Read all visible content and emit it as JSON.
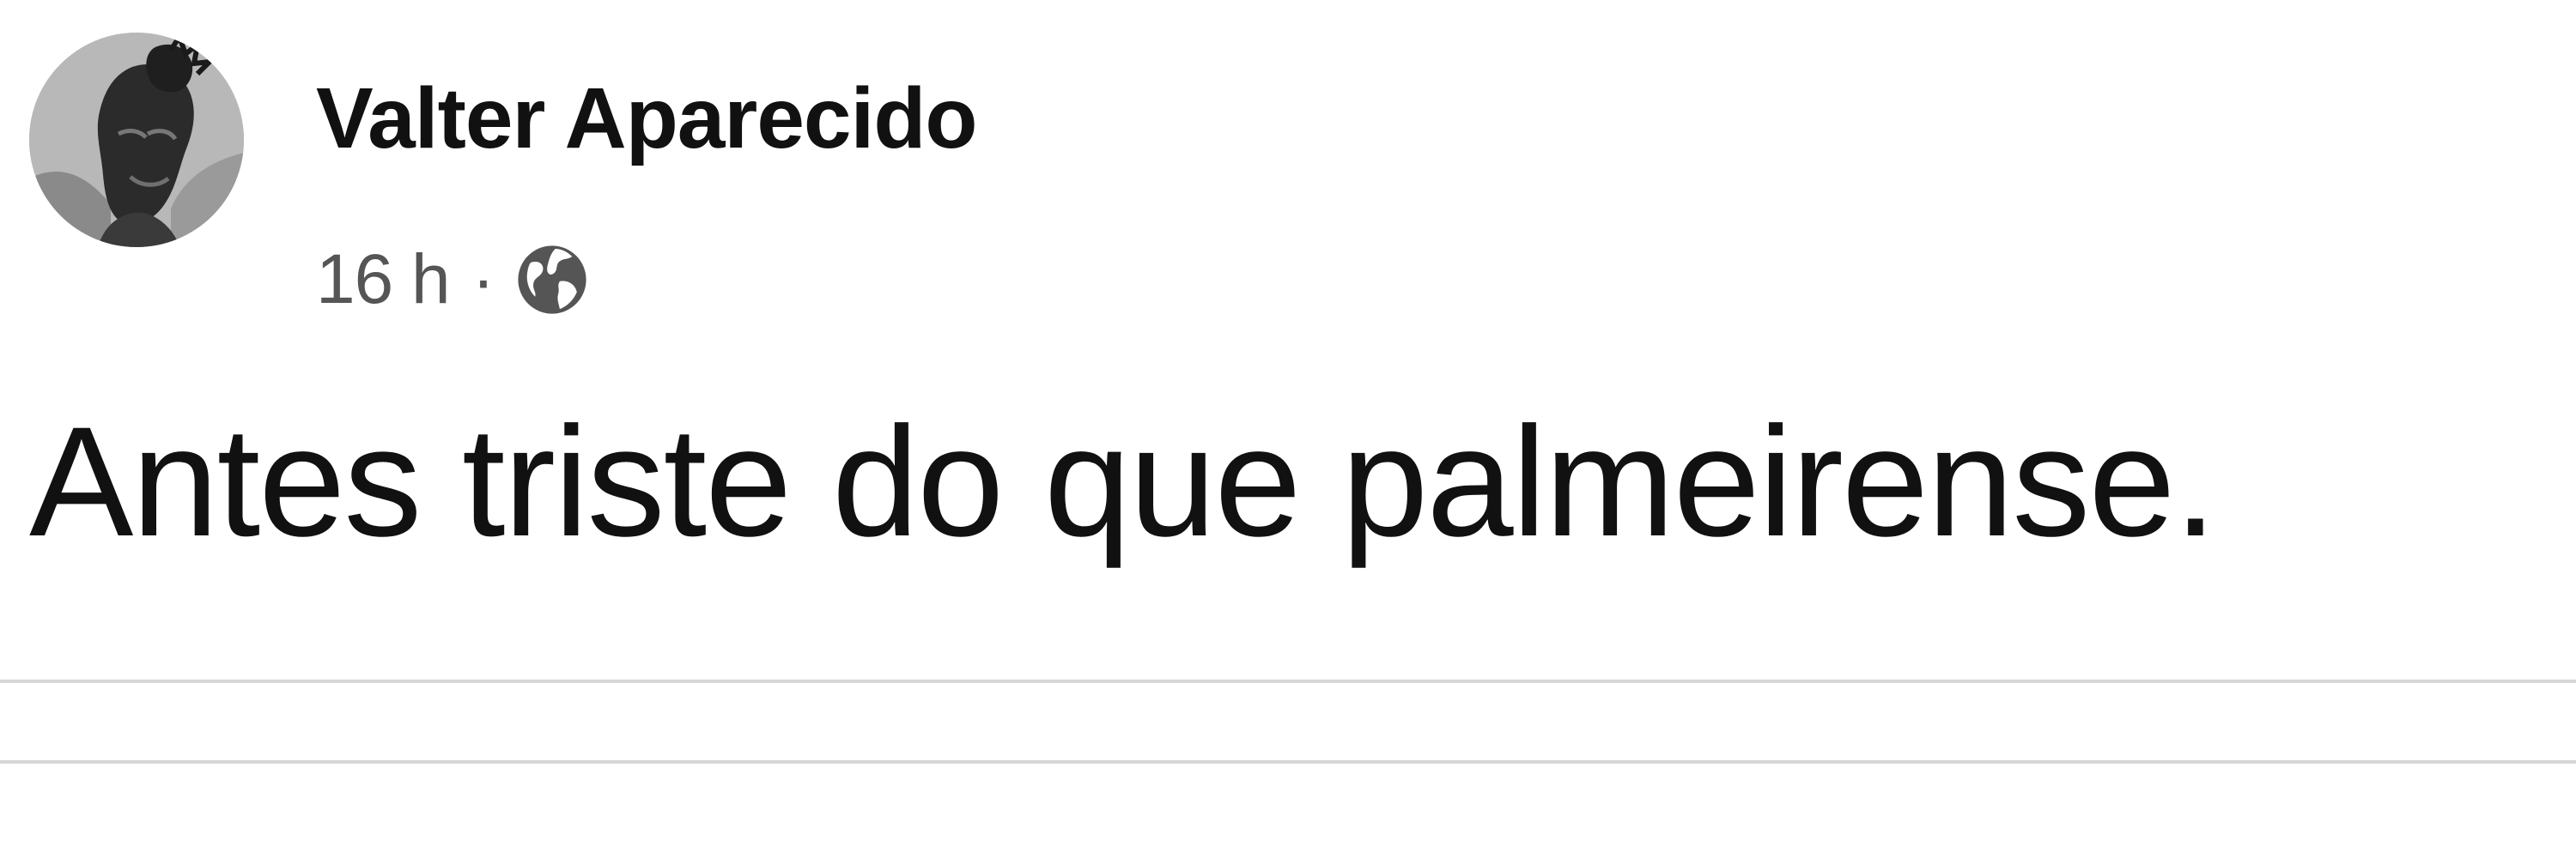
{
  "post": {
    "author_name": "Valter Aparecido",
    "timestamp": "16 h",
    "separator": "·",
    "privacy_icon": "globe-icon",
    "text": "Antes triste do que palmeirense."
  }
}
